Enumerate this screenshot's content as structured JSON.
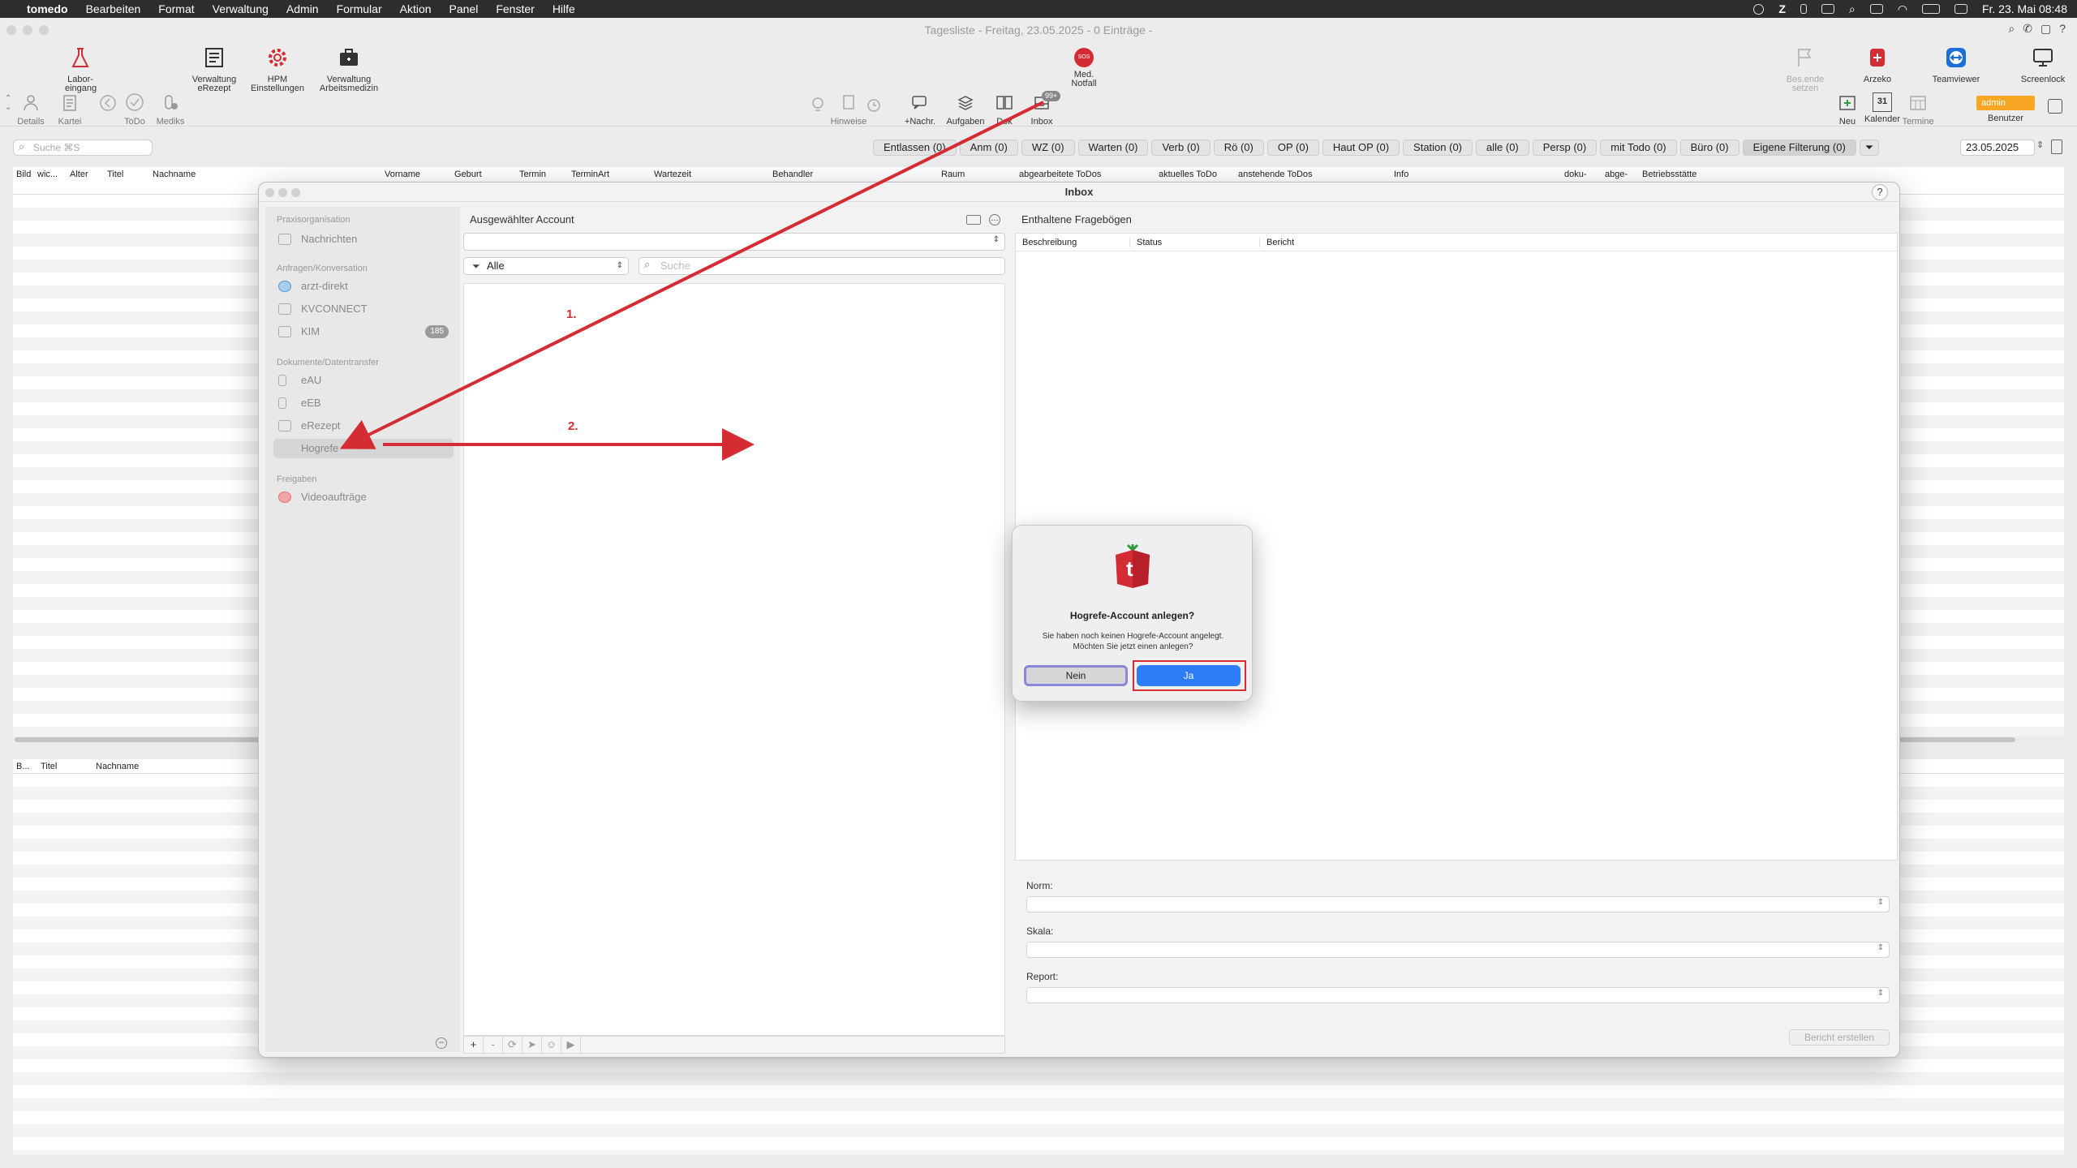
{
  "menubar": {
    "app": "tomedo",
    "items": [
      "Bearbeiten",
      "Format",
      "Verwaltung",
      "Admin",
      "Formular",
      "Aktion",
      "Panel",
      "Fenster",
      "Hilfe"
    ],
    "clock": "Fr. 23. Mai 08:48"
  },
  "window": {
    "title": "Tagesliste - Freitag, 23.05.2025 - 0 Einträge -"
  },
  "toolbar": {
    "labor": "Labor-\neingang",
    "erezept": "Verwaltung\neRezept",
    "hpm": "HPM\nEinstellungen",
    "arbeitsmedizin": "Verwaltung\nArbeitsmedizin",
    "notfall": "Med.\nNotfall",
    "notfall_badge": "SOS",
    "besende": "Bes.ende\nsetzen",
    "arzeko": "Arzeko",
    "teamviewer": "Teamviewer",
    "screenlock": "Screenlock"
  },
  "toolbar2": {
    "details": "Details",
    "kartei": "Kartei",
    "todo": "ToDo",
    "mediks": "Mediks",
    "hinweise": "Hinweise",
    "nachr": "+Nachr.",
    "aufgaben": "Aufgaben",
    "dok": "Dok",
    "inbox": "Inbox",
    "inbox_badge": "99+",
    "neu": "Neu",
    "kalender": "Kalender",
    "kalender_day": "31",
    "termine": "Termine",
    "admin_value": "admin",
    "benutzer": "Benutzer"
  },
  "filterbar": {
    "search_placeholder": "Suche ⌘S",
    "buttons": [
      "Entlassen (0)",
      "Anm (0)",
      "WZ (0)",
      "Warten (0)",
      "Verb (0)",
      "Rö (0)",
      "OP (0)",
      "Haut OP (0)",
      "Station (0)",
      "alle (0)",
      "Persp (0)",
      "mit Todo (0)",
      "Büro (0)",
      "Eigene Filterung (0)"
    ],
    "date": "23.05.2025"
  },
  "list": {
    "columns": [
      "Bild",
      "wic...",
      "Alter",
      "Titel",
      "Nachname",
      "Vorname",
      "Geburt",
      "Termin",
      "TerminArt",
      "Wartezeit",
      "Behandler",
      "Raum",
      "abgearbeitete ToDos",
      "aktuelles ToDo",
      "anstehende ToDos",
      "Info",
      "doku-",
      "abge-",
      "Betriebsstätte"
    ]
  },
  "list2": {
    "columns": [
      "B...",
      "Titel",
      "Nachname"
    ]
  },
  "inbox": {
    "title": "Inbox",
    "help": "?",
    "sidebar": {
      "section1": "Praxisorganisation",
      "nachrichten": "Nachrichten",
      "section2": "Anfragen/Konversation",
      "arzt": "arzt-direkt",
      "kvconnect": "KVCONNECT",
      "kim": "KIM",
      "kim_badge": "185",
      "section3": "Dokumente/Datentransfer",
      "eau": "eAU",
      "eeb": "eEB",
      "erezept": "eRezept",
      "hogrefe": "Hogrefe",
      "section4": "Freigaben",
      "video": "Videoaufträge"
    },
    "middle": {
      "title": "Ausgewählter Account",
      "filter": "Alle",
      "search_placeholder": "Suche",
      "bar": [
        "+",
        "-",
        "⟳",
        "➤",
        "☺",
        "▶"
      ]
    },
    "right": {
      "title": "Enthaltene Fragebögen",
      "columns": [
        "Beschreibung",
        "Status",
        "Bericht"
      ],
      "norm": "Norm:",
      "skala": "Skala:",
      "report": "Report:",
      "bericht_button": "Bericht erstellen"
    }
  },
  "dialog": {
    "title": "Hogrefe-Account anlegen?",
    "message": "Sie haben noch keinen Hogrefe-Account angelegt. Möchten Sie jetzt einen anlegen?",
    "no": "Nein",
    "yes": "Ja"
  },
  "annotations": {
    "step1": "1.",
    "step2": "2.",
    "color": "#d52b32"
  },
  "colors": {
    "accent": "#2f7df6",
    "tomedo_red": "#d42c35",
    "admin_orange": "#f6a623"
  }
}
